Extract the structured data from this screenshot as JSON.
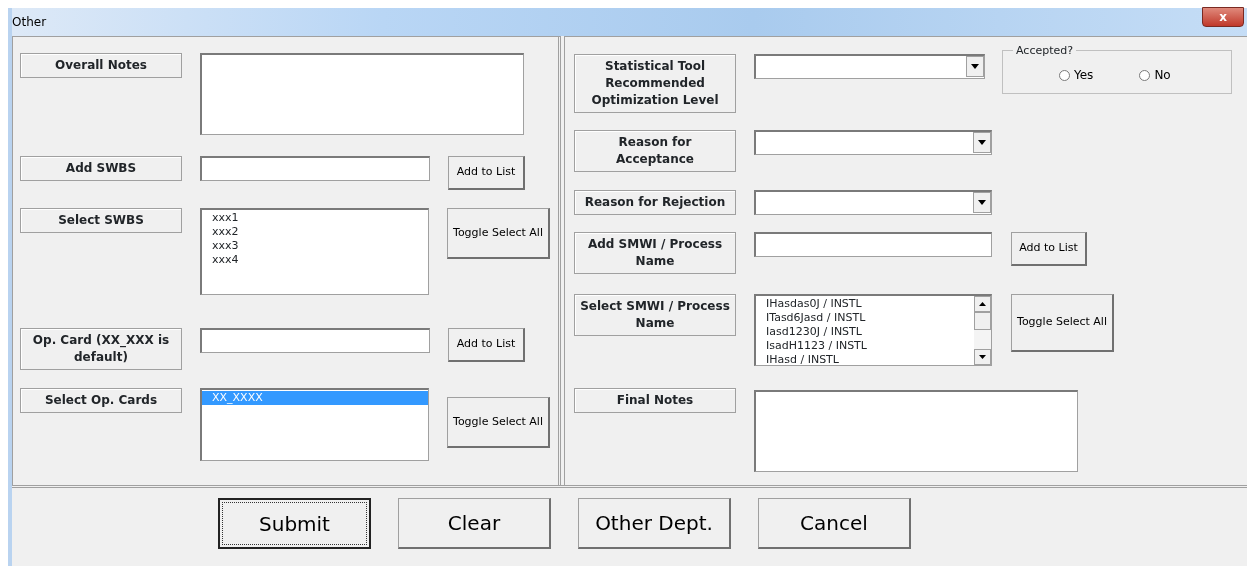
{
  "window": {
    "title": "Other",
    "close_button": "x"
  },
  "left_rows": [
    {
      "label": "Overall Notes",
      "control": {
        "kind": "textarea"
      }
    },
    {
      "label": "Add SWBS",
      "control": {
        "kind": "input"
      },
      "button": "Add to List"
    },
    {
      "label": "Select SWBS",
      "control": {
        "kind": "list",
        "items": [
          {
            "text": "xxx1",
            "selected": false
          },
          {
            "text": "xxx2",
            "selected": false
          },
          {
            "text": "xxx3",
            "selected": false
          },
          {
            "text": "xxx4",
            "selected": false
          }
        ]
      },
      "button": "Toggle Select All"
    },
    {
      "label": "Op. Card (XX_XXX is default)",
      "control": {
        "kind": "input"
      },
      "button": "Add to List"
    },
    {
      "label": "Select Op. Cards",
      "control": {
        "kind": "list",
        "items": [
          {
            "text": "XX_XXXX",
            "selected": true
          }
        ]
      },
      "button": "Toggle Select All"
    }
  ],
  "right_rows": [
    {
      "label": "Statistical Tool Recommended Optimization Level",
      "control": {
        "kind": "combo"
      },
      "group": {
        "title": "Accepted?",
        "options": [
          {
            "label": "Yes",
            "selected": false
          },
          {
            "label": "No",
            "selected": false
          }
        ]
      }
    },
    {
      "label": "Reason for Acceptance",
      "control": {
        "kind": "combo"
      }
    },
    {
      "label": "Reason for Rejection",
      "control": {
        "kind": "combo"
      }
    },
    {
      "label": "Add SMWI / Process Name",
      "control": {
        "kind": "input"
      },
      "button": "Add to List"
    },
    {
      "label": "Select SMWI / Process Name",
      "control": {
        "kind": "list",
        "scrollable": true,
        "items": [
          {
            "text": "IHasdas0J / INSTL",
            "selected": false
          },
          {
            "text": "ITasd6Jasd / INSTL",
            "selected": false
          },
          {
            "text": "Iasd1230J / INSTL",
            "selected": false
          },
          {
            "text": "IsadH1123 / INSTL",
            "selected": false
          },
          {
            "text": "IHasd / INSTL",
            "selected": false
          }
        ]
      },
      "button": "Toggle Select All"
    },
    {
      "label": "Final Notes",
      "control": {
        "kind": "textarea"
      }
    }
  ],
  "buttons": [
    {
      "label": "Submit",
      "focused": true
    },
    {
      "label": "Clear",
      "focused": false
    },
    {
      "label": "Other Dept.",
      "focused": false
    },
    {
      "label": "Cancel",
      "focused": false
    }
  ]
}
